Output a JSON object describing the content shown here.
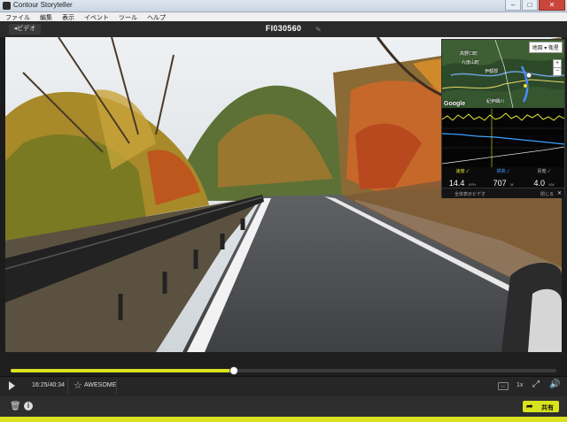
{
  "window": {
    "title": "Contour Storyteller",
    "min_symbol": "–",
    "max_symbol": "□",
    "close_symbol": "✕"
  },
  "menu": [
    "ファイル",
    "編集",
    "表示",
    "イベント",
    "ツール",
    "ヘルプ"
  ],
  "toolbar": {
    "back_label": "◂ビデオ",
    "file_title": "FI030560",
    "edit_symbol": "✎"
  },
  "overlay": {
    "map": {
      "type_label": "地図 ▾ 衛星",
      "zoom_in": "+",
      "zoom_out": "−",
      "provider": "Google",
      "labels": [
        "伊都郡",
        "九度山町",
        "高野口町",
        "紀伊細川"
      ]
    },
    "stats": [
      {
        "label": "速度 ✓",
        "value": "14.4",
        "unit": "KPH",
        "color": "yellow"
      },
      {
        "label": "標高 ✓",
        "value": "707",
        "unit": "M",
        "color": "blue"
      },
      {
        "label": "距離 ✓",
        "value": "4.0",
        "unit": "KM",
        "color": "gray"
      }
    ],
    "footer_left": "全体表示ビデオ",
    "footer_right": "閉じる",
    "close_symbol": "✕"
  },
  "playback": {
    "progress": 0.408,
    "time": "16:25/40:34",
    "favorite_label": "AWESOME",
    "speed": "1x",
    "cc_label": "CC"
  },
  "share_label": "共有",
  "colors": {
    "accent": "#d8e21e",
    "speed_line": "#e2e53a",
    "elevation_line": "#3aa0ff"
  }
}
